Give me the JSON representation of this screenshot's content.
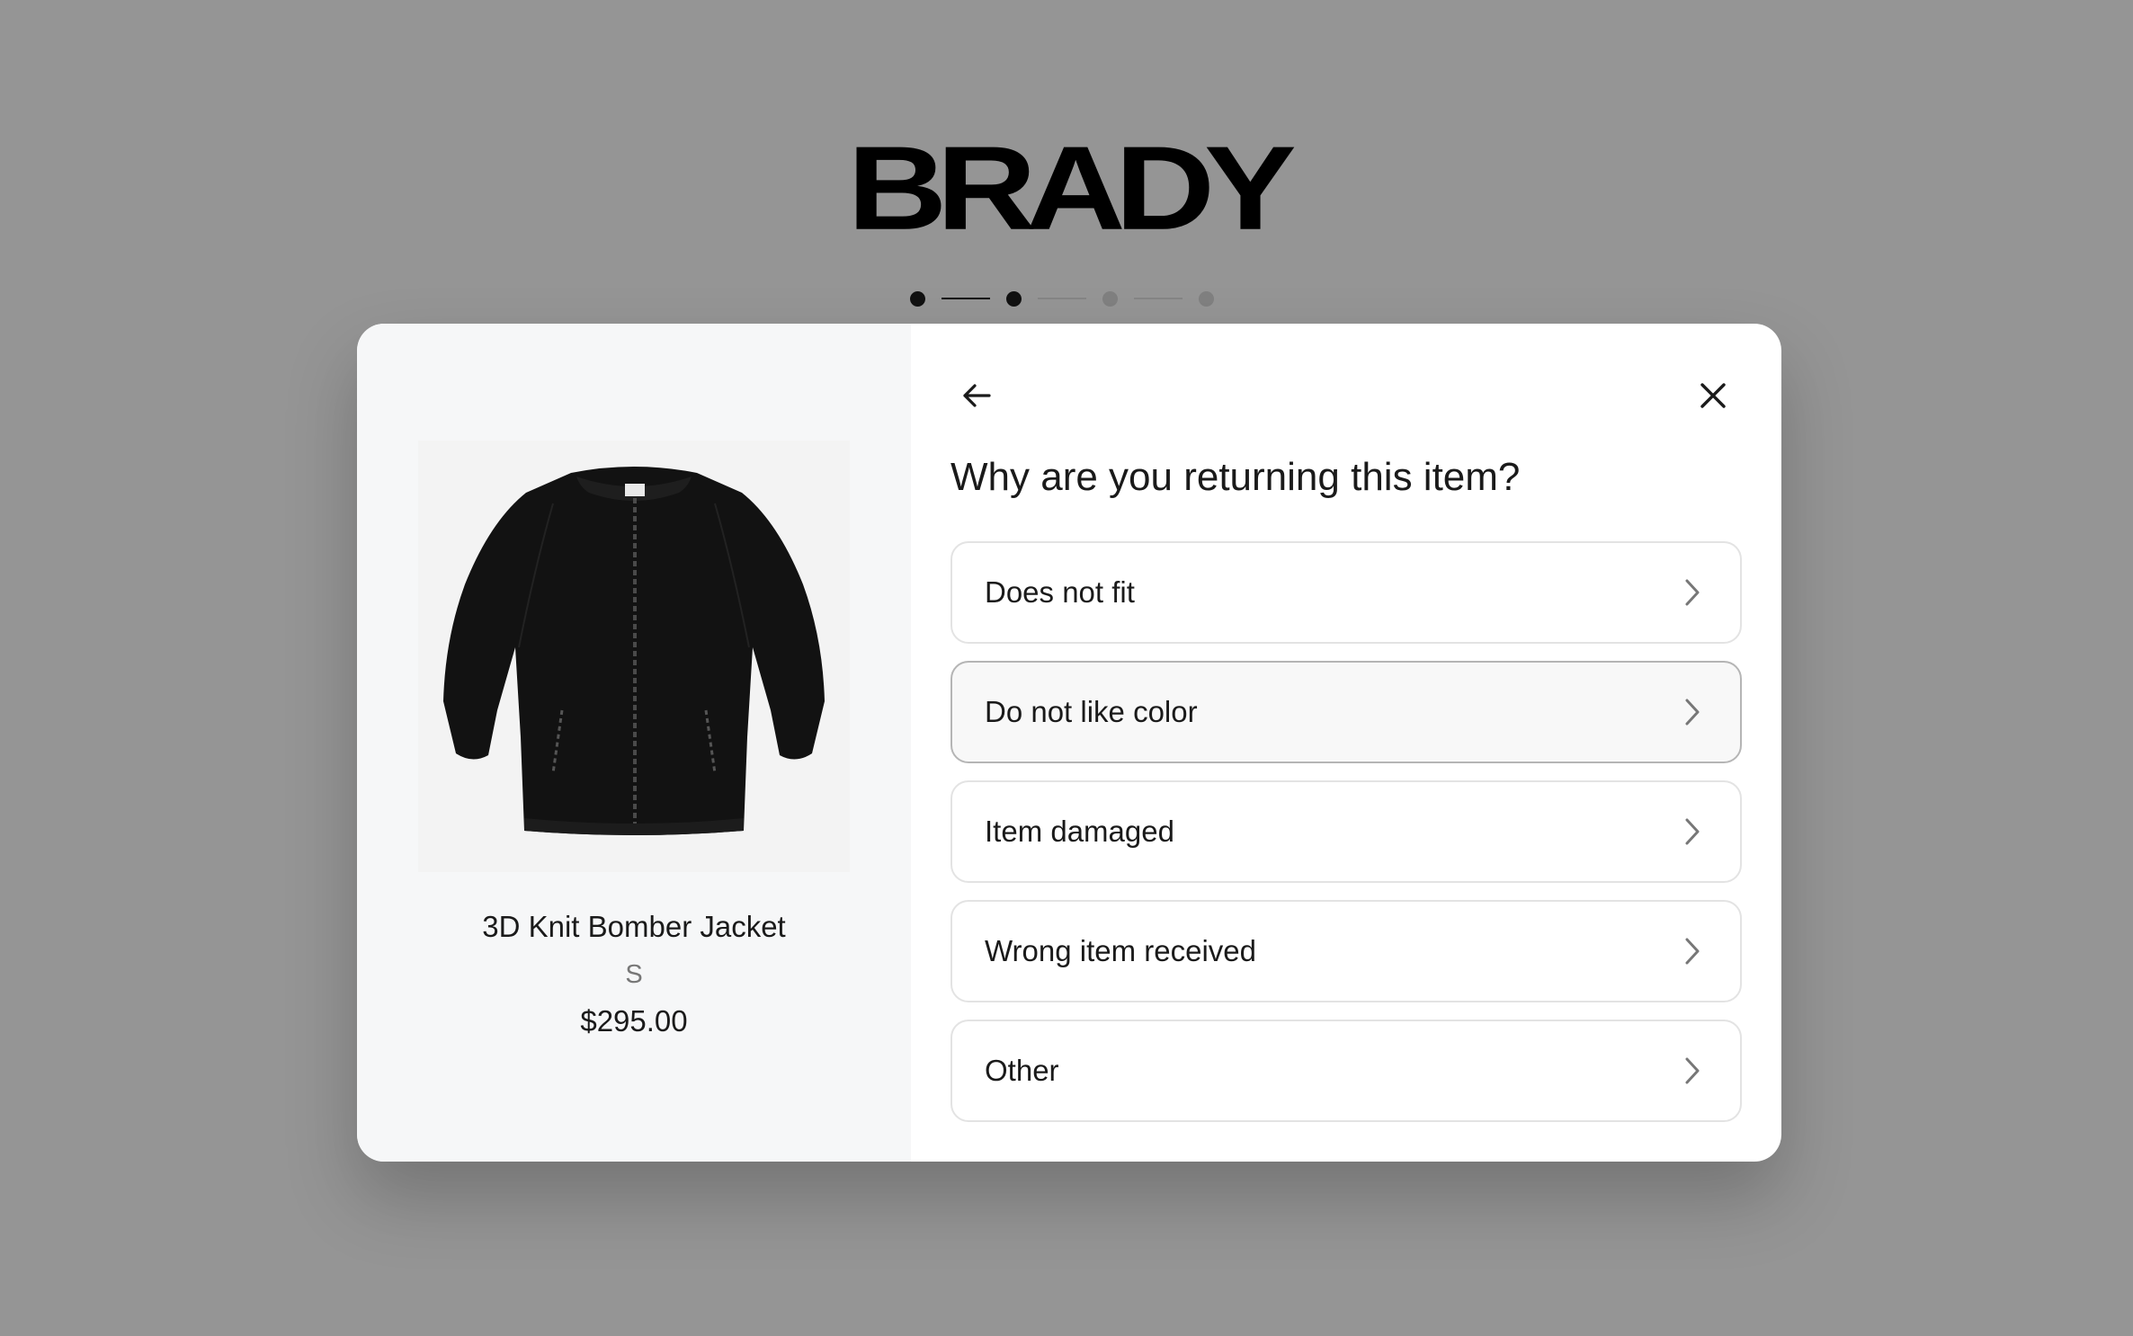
{
  "brand": {
    "logo_text": "BRADY"
  },
  "stepper": {
    "total_steps": 4,
    "completed_steps": 2
  },
  "product": {
    "name": "3D Knit Bomber Jacket",
    "size": "S",
    "price": "$295.00",
    "image_icon": "jacket-photo"
  },
  "dialog": {
    "back_icon": "arrow-left-icon",
    "close_icon": "close-icon",
    "question": "Why are you returning this item?",
    "reasons": [
      {
        "label": "Does not fit"
      },
      {
        "label": "Do not like color"
      },
      {
        "label": "Item damaged"
      },
      {
        "label": "Wrong item received"
      },
      {
        "label": "Other"
      }
    ],
    "hovered_reason_index": 1
  },
  "colors": {
    "backdrop": "#959595",
    "modal": "#ffffff",
    "product_panel": "#f6f7f8",
    "text_primary": "#1a1a1a",
    "text_muted": "#777777",
    "step_active": "#111111",
    "step_inactive": "#808080"
  }
}
